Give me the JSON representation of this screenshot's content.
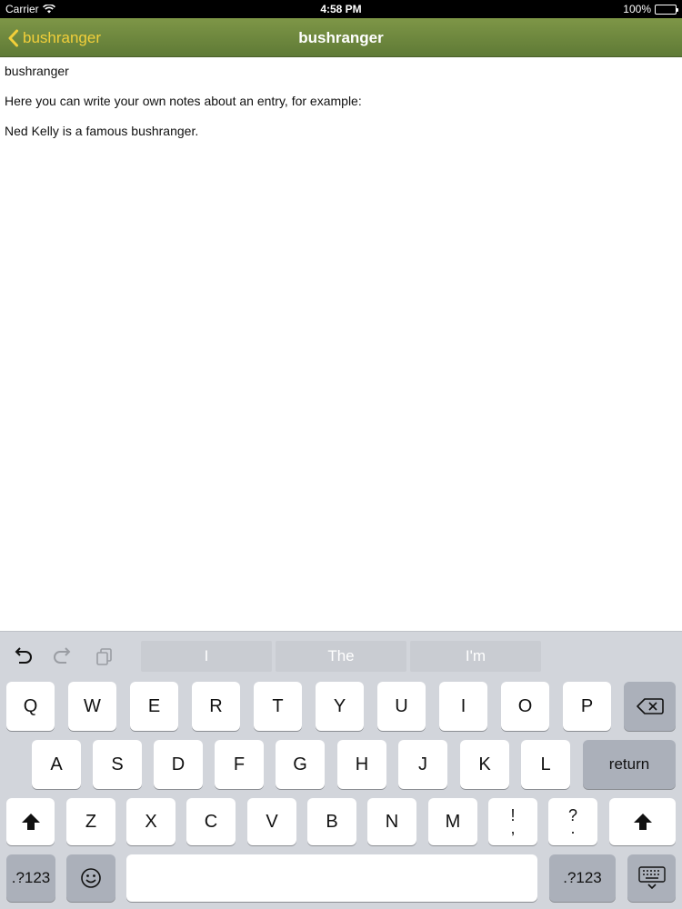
{
  "status_bar": {
    "carrier": "Carrier",
    "time": "4:58 PM",
    "battery": "100%"
  },
  "nav": {
    "back_label": "bushranger",
    "title": "bushranger"
  },
  "notes": {
    "lines": [
      "bushranger",
      "Here you can write your own notes about an entry, for example:",
      "Ned Kelly is a famous bushranger."
    ]
  },
  "keyboard": {
    "suggestions": [
      "I",
      "The",
      "I'm"
    ],
    "row1": [
      "Q",
      "W",
      "E",
      "R",
      "T",
      "Y",
      "U",
      "I",
      "O",
      "P"
    ],
    "row2": [
      "A",
      "S",
      "D",
      "F",
      "G",
      "H",
      "J",
      "K",
      "L"
    ],
    "row3": [
      "Z",
      "X",
      "C",
      "V",
      "B",
      "N",
      "M"
    ],
    "punct1": {
      "top": "!",
      "bottom": ","
    },
    "punct2": {
      "top": "?",
      "bottom": "."
    },
    "return_label": "return",
    "numbers_label": ".?123",
    "icons": [
      "undo-icon",
      "redo-icon",
      "paste-icon",
      "backspace-icon",
      "shift-icon",
      "emoji-icon",
      "keyboard-dismiss-icon"
    ]
  },
  "colors": {
    "nav_bar": "#6f883f",
    "back_accent": "#f2cf3a",
    "keyboard_bg": "#d2d5db"
  }
}
